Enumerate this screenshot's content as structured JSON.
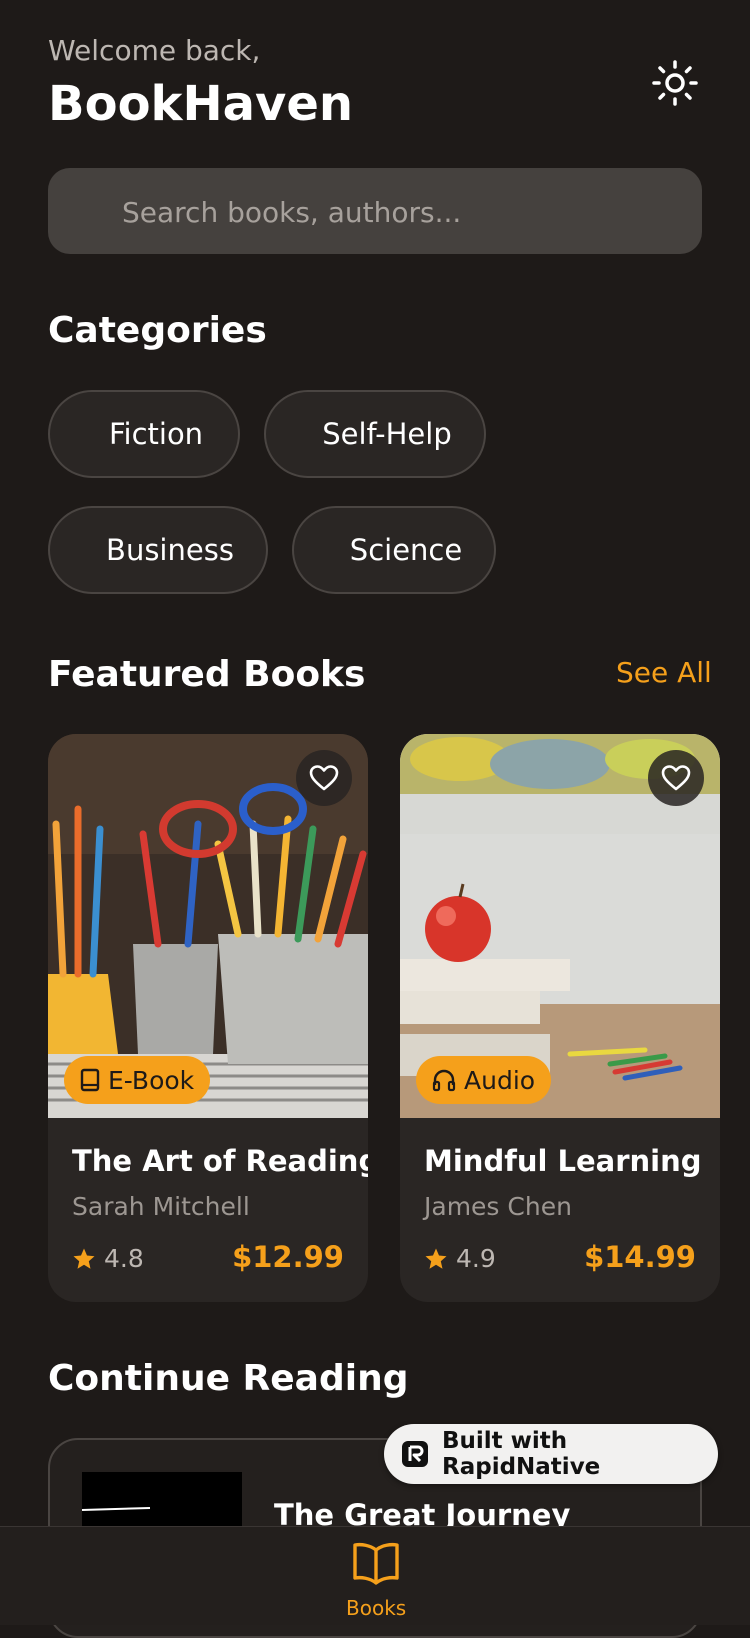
{
  "header": {
    "welcome": "Welcome back,",
    "title": "BookHaven"
  },
  "search": {
    "placeholder": "Search books, authors..."
  },
  "categories": {
    "title": "Categories",
    "items": [
      "Fiction",
      "Self-Help",
      "Business",
      "Science"
    ]
  },
  "featured": {
    "title": "Featured Books",
    "see_all": "See All",
    "books": [
      {
        "badge": "E-Book",
        "badge_icon": "book-icon",
        "title": "The Art of Reading",
        "author": "Sarah Mitchell",
        "rating": "4.8",
        "price": "$12.99"
      },
      {
        "badge": "Audio",
        "badge_icon": "headphones-icon",
        "title": "Mindful Learning",
        "author": "James Chen",
        "rating": "4.9",
        "price": "$14.99"
      }
    ]
  },
  "continue_reading": {
    "title": "Continue Reading",
    "book_title": "The Great Journey"
  },
  "built_with": {
    "label": "Built with RapidNative"
  },
  "bottom_nav": {
    "books_label": "Books"
  },
  "colors": {
    "accent": "#f5a01b",
    "background": "#1e1a18",
    "card": "#2a2624"
  }
}
